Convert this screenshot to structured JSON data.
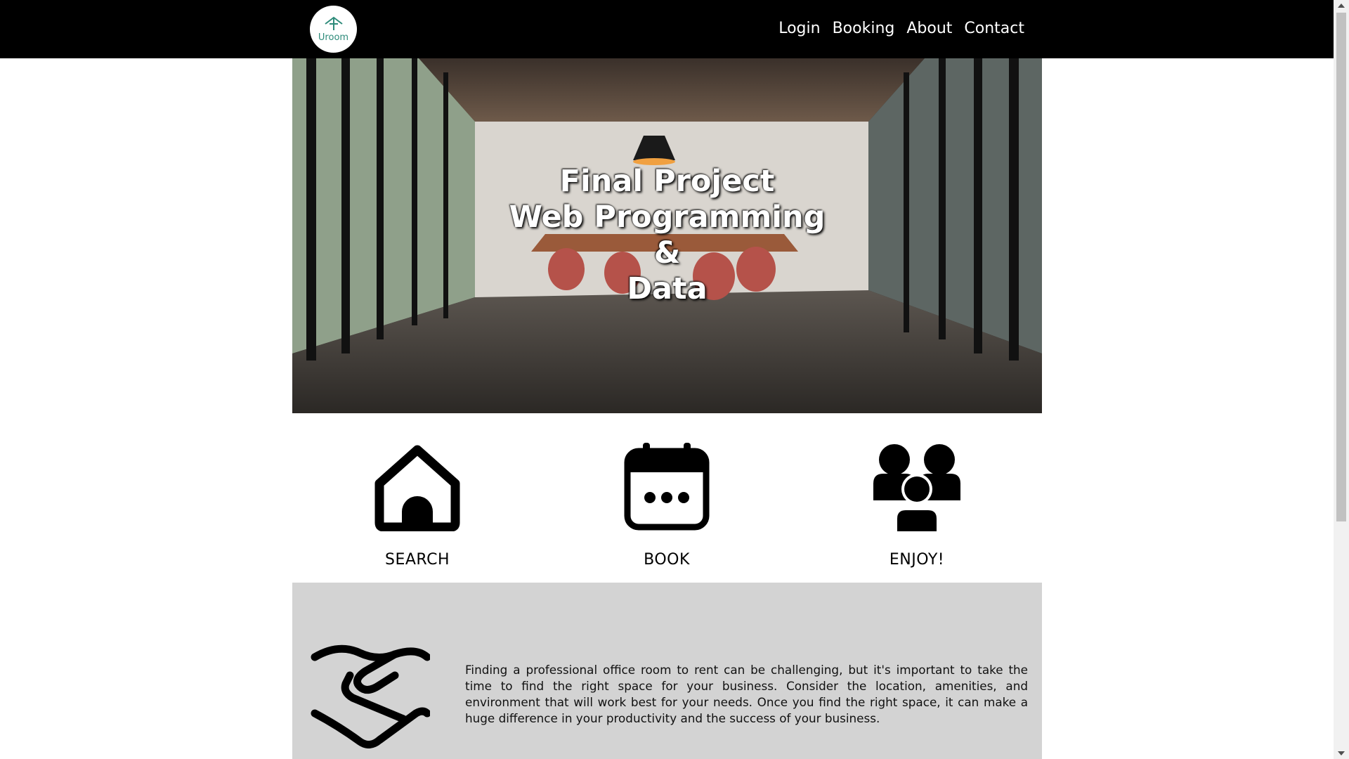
{
  "nav": {
    "logo_text": "Uroom",
    "links": [
      "Login",
      "Booking",
      "About",
      "Contact"
    ]
  },
  "hero": {
    "title_lines": [
      "Final Project",
      "Web Programming",
      "&",
      "Data"
    ]
  },
  "features": [
    {
      "label": "SEARCH",
      "icon": "house-icon"
    },
    {
      "label": "BOOK",
      "icon": "calendar-icon"
    },
    {
      "label": "ENJOY!",
      "icon": "people-group-icon"
    }
  ],
  "about": {
    "icon": "handshake-icon",
    "text": "Finding a professional office room to rent can be challenging, but it's important to take the time to find the right space for your business. Consider the location, amenities, and environment that will work best for your needs. Once you find the right space, it can make a huge difference in your productivity and the success of your business."
  },
  "colors": {
    "navbar": "#000000",
    "logo_accent": "#2e8b7a",
    "about_background": "#d3d3d3"
  }
}
